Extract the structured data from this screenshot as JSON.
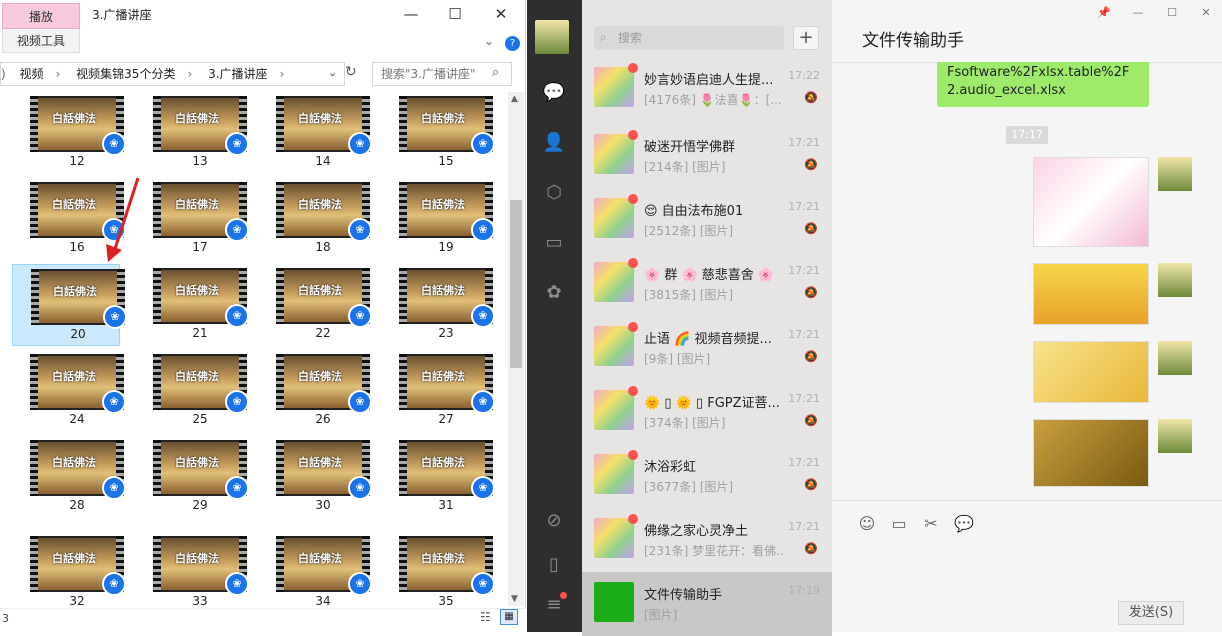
{
  "explorer": {
    "ribbon_tab": "播放",
    "ribbon_sub": "视频工具",
    "title": "3.广播讲座",
    "breadcrumb": [
      "视频",
      "视频集锦35个分类",
      "3.广播讲座"
    ],
    "search_placeholder": "搜索\"3.广播讲座\"",
    "status_count": "3",
    "thumbnail_caption": "白話佛法",
    "files": [
      "12",
      "13",
      "14",
      "15",
      "16",
      "17",
      "18",
      "19",
      "20",
      "21",
      "22",
      "23",
      "24",
      "25",
      "26",
      "27",
      "28",
      "29",
      "30",
      "31",
      "32",
      "33",
      "34",
      "35"
    ],
    "selected_file": "20"
  },
  "wechat": {
    "search_placeholder": "搜索",
    "chats": [
      {
        "name": "妙言妙语启迪人生提...",
        "time": "17:22",
        "preview": "[4176条] 🌷法喜🌷：[..."
      },
      {
        "name": "破迷开悟学佛群",
        "time": "17:21",
        "preview": "[214条] [图片]"
      },
      {
        "name": "😌 自由法布施01",
        "time": "17:21",
        "preview": "[2512条] [图片]"
      },
      {
        "name": "🌸 群 🌸 慈悲喜舍 🌸",
        "time": "17:21",
        "preview": "[3815条] [图片]"
      },
      {
        "name": "止语 🌈 视频音频提...",
        "time": "17:21",
        "preview": "[9条] [图片]"
      },
      {
        "name": "🌞 ▯ 🌞 ▯ FGPZ证菩...",
        "time": "17:21",
        "preview": "[374条] [图片]"
      },
      {
        "name": "沐浴彩虹",
        "time": "17:21",
        "preview": "[3677条] [图片]"
      },
      {
        "name": "佛缘之家心灵净土",
        "time": "17:21",
        "preview": "[231条] 梦里花开：看佛..."
      },
      {
        "name": "文件传输助手",
        "time": "17:19",
        "preview": "[图片]"
      }
    ],
    "chat_title": "文件传输助手",
    "message_text": "Fsoftware%2Fxlsx.table%2F2.audio_excel.xlsx",
    "timestamp": "17:17",
    "send_label": "发送(S)"
  }
}
